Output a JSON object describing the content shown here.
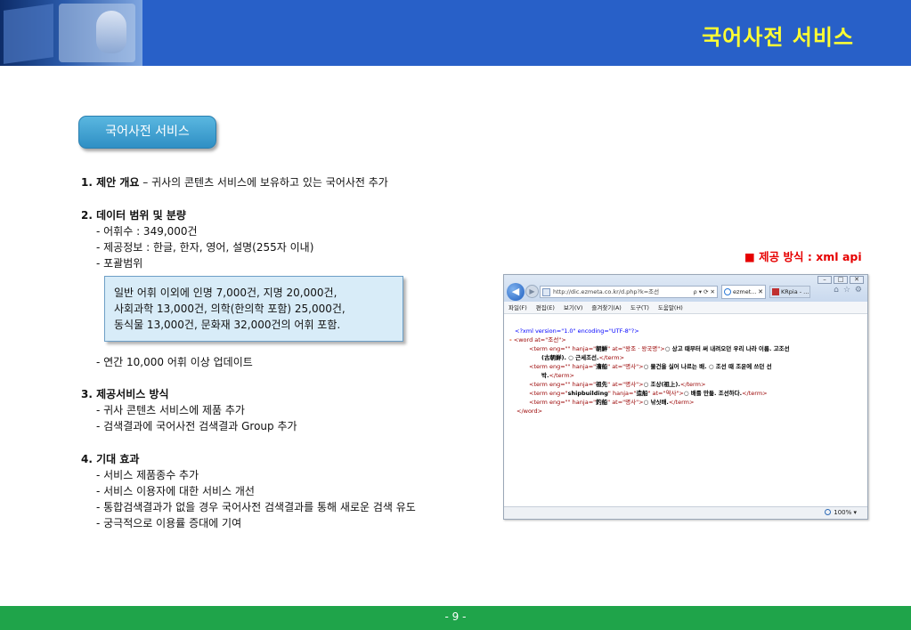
{
  "header": {
    "title": "국어사전 서비스"
  },
  "pill": {
    "label": "국어사전 서비스"
  },
  "content": {
    "s1": {
      "heading": "1. 제안 개요",
      "text": " – 귀사의 콘텐츠 서비스에 보유하고 있는 국어사전 추가"
    },
    "s2": {
      "heading": "2. 데이터 범위 및 분량",
      "lines": [
        "- 어휘수 : 349,000건",
        "- 제공정보 : 한글, 한자, 영어, 설명(255자 이내)",
        "- 포괄범위"
      ],
      "box_lines": [
        "일반 어휘 이외에 인명 7,000건, 지명 20,000건,",
        "사회과학   13,000건, 의학(한의학 포함) 25,000건,",
        "동식물 13,000건, 문화재 32,000건의 어휘 포함."
      ],
      "update": "- 연간 10,000 어휘 이상 업데이트"
    },
    "s3": {
      "heading": "3. 제공서비스 방식",
      "lines": [
        "- 귀사 콘텐츠 서비스에 제품 추가",
        "- 검색결과에 국어사전 검색결과 Group 추가"
      ]
    },
    "s4": {
      "heading": "4. 기대 효과",
      "lines": [
        "- 서비스 제품종수 추가",
        "- 서비스 이용자에 대한 서비스 개선",
        "- 통합검색결과가 없을 경우 국어사전 검색결과를 통해 새로운 검색 유도",
        "- 궁극적으로 이용률 증대에 기여"
      ]
    }
  },
  "method": {
    "label": "■ 제공 방식 : xml api"
  },
  "browser": {
    "url": "http://dic.ezmeta.co.kr/d.php?k=조선",
    "url_controls": "ρ ▾ ⟳ ✕",
    "tab1": "ezmet...",
    "tab1_close": "✕",
    "tab2": "KRpia - ...",
    "menu": [
      "파일(F)",
      "편집(E)",
      "보기(V)",
      "즐겨찾기(A)",
      "도구(T)",
      "도움말(H)"
    ],
    "xml": {
      "decl": "<?xml version=\"1.0\" encoding=\"UTF-8\"?>",
      "minus": "-",
      "word_open": "<word at=\"조선\">",
      "term1_tag": "<term eng=\"\" hanja=\"",
      "term1_hanja": "朝鮮",
      "term1_mid": "\" at=\"왕조 · 왕국명\">",
      "term1_text": "○ 상고 때부터 써 내려오던 우리 나라 이름. 고조선",
      "term1_text2": "(古朝鮮). ○ 근세조선.",
      "term_close": "</term>",
      "term2_tag": "<term eng=\"\" hanja=\"",
      "term2_hanja": "漕船",
      "term2_mid": "\" at=\"명사\">",
      "term2_text": "○ 물건을 실어 나르는 배. ○ 조선 때 조운에 쓰던 선",
      "term2_text2": "박.",
      "term3_tag": "<term eng=\"\" hanja=\"",
      "term3_hanja": "祖先",
      "term3_mid": "\" at=\"명사\">",
      "term3_text": "○ 조상(祖上).",
      "term4_tag": "<term eng=\"",
      "term4_eng": "shipbuilding",
      "term4_hanja_attr": "\" hanja=\"",
      "term4_hanja": "造船",
      "term4_mid": "\" at=\"역사\">",
      "term4_text": "○ 배를 만듦. 조선하다.",
      "term5_tag": "<term eng=\"\" hanja=\"",
      "term5_hanja": "釣船",
      "term5_mid": "\" at=\"명사\">",
      "term5_text": "○ 낚싯배.",
      "word_close": "</word>"
    },
    "zoom": "100%",
    "zoom_caret": "▾"
  },
  "footer": {
    "page": "- 9 -"
  }
}
